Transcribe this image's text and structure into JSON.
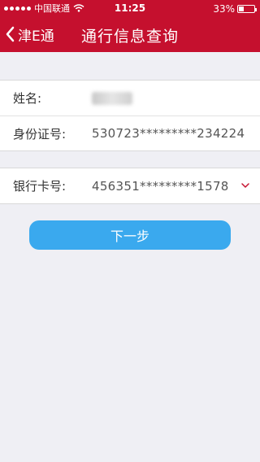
{
  "status_bar": {
    "carrier": "中国联通",
    "time": "11:25",
    "battery_pct": "33%",
    "battery_level": 0.33
  },
  "nav": {
    "back_label": "津E通",
    "title": "通行信息查询"
  },
  "form": {
    "name_label": "姓名:",
    "id_label": "身份证号:",
    "id_value": "530723*********234224",
    "bank_label": "银行卡号:",
    "bank_value": "456351*********1578"
  },
  "actions": {
    "next_label": "下一步"
  },
  "colors": {
    "brand": "#c5102e",
    "button": "#3aa9ee",
    "background": "#efeff4"
  }
}
